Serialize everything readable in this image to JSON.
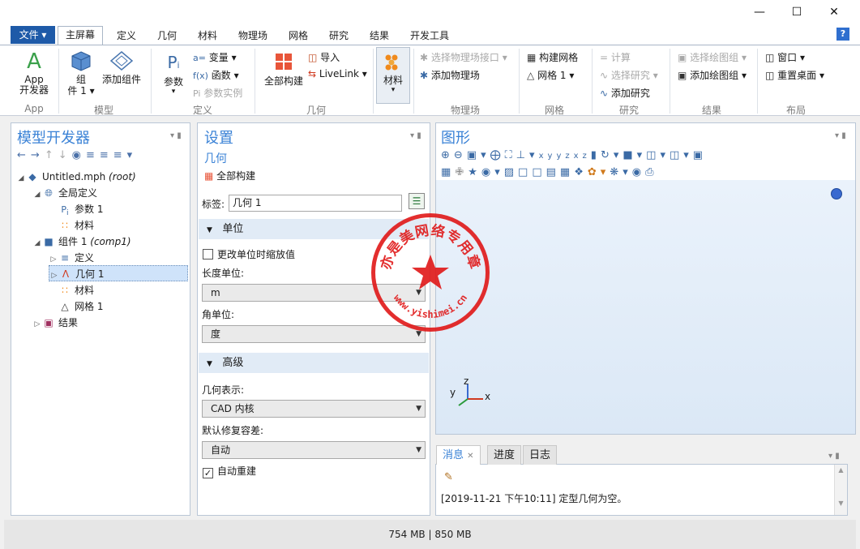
{
  "window": {
    "minimize_icon": "minimize-icon",
    "maximize_icon": "maximize-icon",
    "close_icon": "close-icon"
  },
  "ribbon_tabs": {
    "file": "文件 ▾",
    "home": "主屏幕",
    "definitions": "定义",
    "geometry": "几何",
    "materials": "材料",
    "physics": "物理场",
    "mesh": "网格",
    "study": "研究",
    "results": "结果",
    "developer": "开发工具",
    "help": "?"
  },
  "ribbon": {
    "app_builder_1": "App",
    "app_builder_2": "开发器",
    "group_app": "App",
    "component_1": "组",
    "component_2": "件 1 ▾",
    "add_component": "添加组件",
    "group_model": "模型",
    "parameters": "参数",
    "variables": "变量 ▾",
    "functions": "函数 ▾",
    "param_case": "参数实例",
    "group_definitions": "定义",
    "build_all": "全部构建",
    "import": "导入",
    "livelink": "LiveLink ▾",
    "group_geometry": "几何",
    "materials": "材料",
    "select_physics_interface": "选择物理场接口 ▾",
    "add_physics": "添加物理场",
    "group_physics": "物理场",
    "build_mesh": "构建网格",
    "mesh1": "网格 1 ▾",
    "group_mesh": "网格",
    "compute": "计算",
    "select_study": "选择研究 ▾",
    "add_study": "添加研究",
    "group_study": "研究",
    "select_plot_group": "选择绘图组 ▾",
    "add_plot_group": "添加绘图组 ▾",
    "group_results": "结果",
    "windows": "窗口 ▾",
    "reset_desktop": "重置桌面 ▾",
    "group_layout": "布局"
  },
  "model_builder": {
    "title": "模型开发器",
    "tree": {
      "root_name": "Untitled.mph",
      "root_tag": "(root)",
      "global_defs": "全局定义",
      "params1": "参数 1",
      "global_materials": "材料",
      "comp1_name": "组件 1",
      "comp1_tag": "(comp1)",
      "definitions": "定义",
      "geometry1": "几何 1",
      "materials": "材料",
      "mesh1": "网格 1",
      "results": "结果"
    }
  },
  "settings": {
    "title": "设置",
    "subtitle": "几何",
    "build_all": "全部构建",
    "label_caption": "标签:",
    "label_value": "几何 1",
    "units_section": "单位",
    "scale_values": "更改单位时缩放值",
    "length_unit_caption": "长度单位:",
    "length_unit": "m",
    "angle_unit_caption": "角单位:",
    "angle_unit": "度",
    "advanced_section": "高级",
    "geom_rep_caption": "几何表示:",
    "geom_rep": "CAD 内核",
    "repair_tol_caption": "默认修复容差:",
    "repair_tol": "自动",
    "auto_rebuild": "自动重建",
    "auto_rebuild_checked": "✓"
  },
  "graphics": {
    "title": "图形",
    "axis_x": "x",
    "axis_y": "y",
    "axis_z": "z"
  },
  "messages": {
    "tab_messages": "消息",
    "tab_progress": "进度",
    "tab_log": "日志",
    "close_x": "✕",
    "log_line": "[2019-11-21 下午10:11] 定型几何为空。"
  },
  "status": {
    "memory": "754 MB | 850 MB"
  },
  "stamp": {
    "top_text": "亦是美网络专用章",
    "bottom_text": "www.yishimei.cn"
  },
  "colors": {
    "accent_blue": "#3a82d6",
    "file_blue": "#1e5aa8",
    "stamp_red": "#e01818",
    "graphics_bg": "#e8f0fa"
  }
}
